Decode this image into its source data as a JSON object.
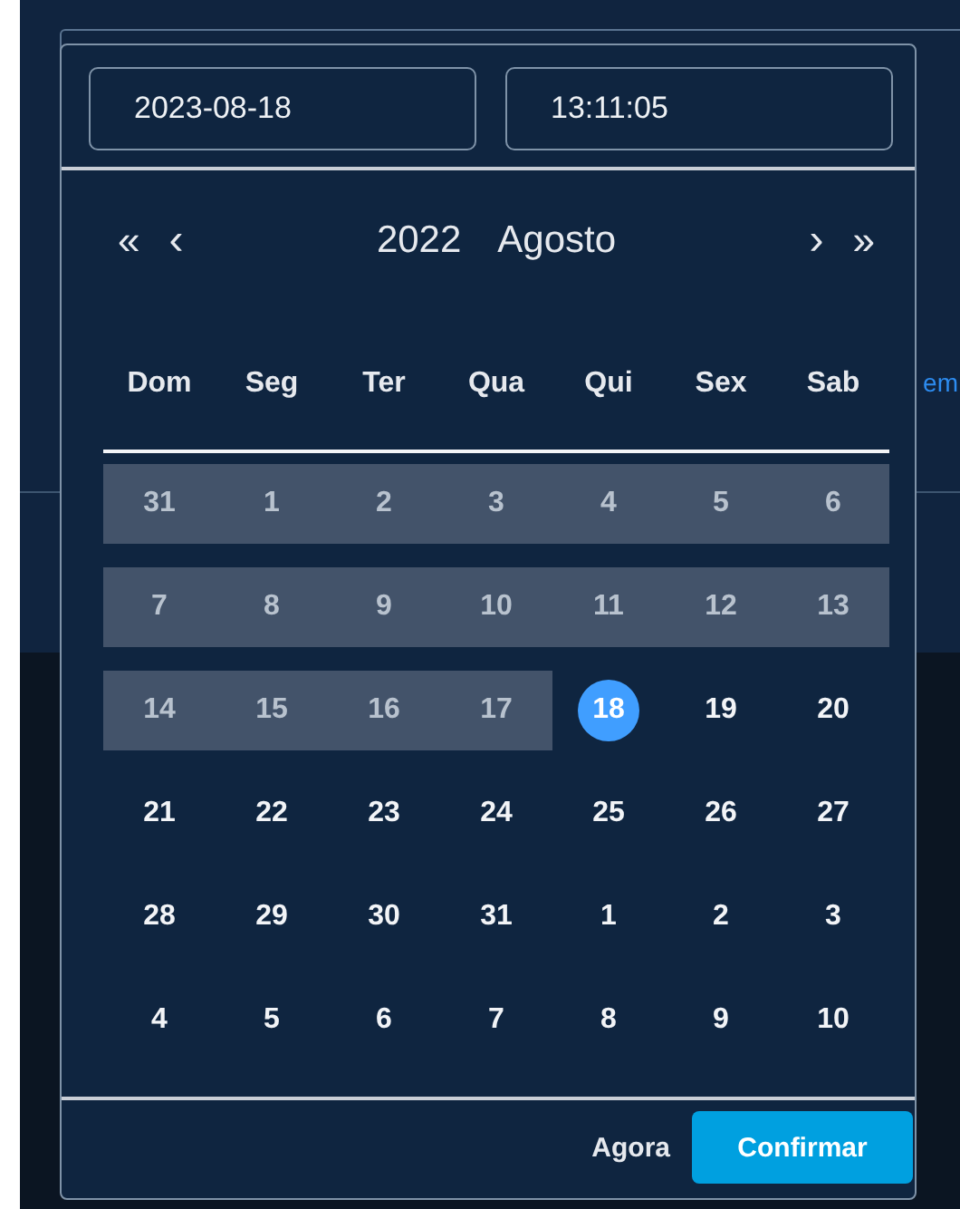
{
  "background": {
    "link_text": "em"
  },
  "date_field": {
    "value": "2023-08-18"
  },
  "time_field": {
    "value": "13:11:05"
  },
  "nav": {
    "prev_year": "«",
    "prev_month": "‹",
    "year": "2022",
    "month": "Agosto",
    "next_month": "›",
    "next_year": "»"
  },
  "weekdays": [
    "Dom",
    "Seg",
    "Ter",
    "Qua",
    "Qui",
    "Sex",
    "Sab"
  ],
  "weeks": [
    [
      {
        "day": "31",
        "in_range": true,
        "selected": false
      },
      {
        "day": "1",
        "in_range": true,
        "selected": false
      },
      {
        "day": "2",
        "in_range": true,
        "selected": false
      },
      {
        "day": "3",
        "in_range": true,
        "selected": false
      },
      {
        "day": "4",
        "in_range": true,
        "selected": false
      },
      {
        "day": "5",
        "in_range": true,
        "selected": false
      },
      {
        "day": "6",
        "in_range": true,
        "selected": false
      }
    ],
    [
      {
        "day": "7",
        "in_range": true,
        "selected": false
      },
      {
        "day": "8",
        "in_range": true,
        "selected": false
      },
      {
        "day": "9",
        "in_range": true,
        "selected": false
      },
      {
        "day": "10",
        "in_range": true,
        "selected": false
      },
      {
        "day": "11",
        "in_range": true,
        "selected": false
      },
      {
        "day": "12",
        "in_range": true,
        "selected": false
      },
      {
        "day": "13",
        "in_range": true,
        "selected": false
      }
    ],
    [
      {
        "day": "14",
        "in_range": true,
        "selected": false
      },
      {
        "day": "15",
        "in_range": true,
        "selected": false
      },
      {
        "day": "16",
        "in_range": true,
        "selected": false
      },
      {
        "day": "17",
        "in_range": true,
        "selected": false
      },
      {
        "day": "18",
        "in_range": false,
        "selected": true
      },
      {
        "day": "19",
        "in_range": false,
        "selected": false
      },
      {
        "day": "20",
        "in_range": false,
        "selected": false
      }
    ],
    [
      {
        "day": "21",
        "in_range": false,
        "selected": false
      },
      {
        "day": "22",
        "in_range": false,
        "selected": false
      },
      {
        "day": "23",
        "in_range": false,
        "selected": false
      },
      {
        "day": "24",
        "in_range": false,
        "selected": false
      },
      {
        "day": "25",
        "in_range": false,
        "selected": false
      },
      {
        "day": "26",
        "in_range": false,
        "selected": false
      },
      {
        "day": "27",
        "in_range": false,
        "selected": false
      }
    ],
    [
      {
        "day": "28",
        "in_range": false,
        "selected": false
      },
      {
        "day": "29",
        "in_range": false,
        "selected": false
      },
      {
        "day": "30",
        "in_range": false,
        "selected": false
      },
      {
        "day": "31",
        "in_range": false,
        "selected": false
      },
      {
        "day": "1",
        "in_range": false,
        "selected": false
      },
      {
        "day": "2",
        "in_range": false,
        "selected": false
      },
      {
        "day": "3",
        "in_range": false,
        "selected": false
      }
    ],
    [
      {
        "day": "4",
        "in_range": false,
        "selected": false
      },
      {
        "day": "5",
        "in_range": false,
        "selected": false
      },
      {
        "day": "6",
        "in_range": false,
        "selected": false
      },
      {
        "day": "7",
        "in_range": false,
        "selected": false
      },
      {
        "day": "8",
        "in_range": false,
        "selected": false
      },
      {
        "day": "9",
        "in_range": false,
        "selected": false
      },
      {
        "day": "10",
        "in_range": false,
        "selected": false
      }
    ]
  ],
  "footer": {
    "now_button": "Agora",
    "confirm_button": "Confirmar"
  }
}
